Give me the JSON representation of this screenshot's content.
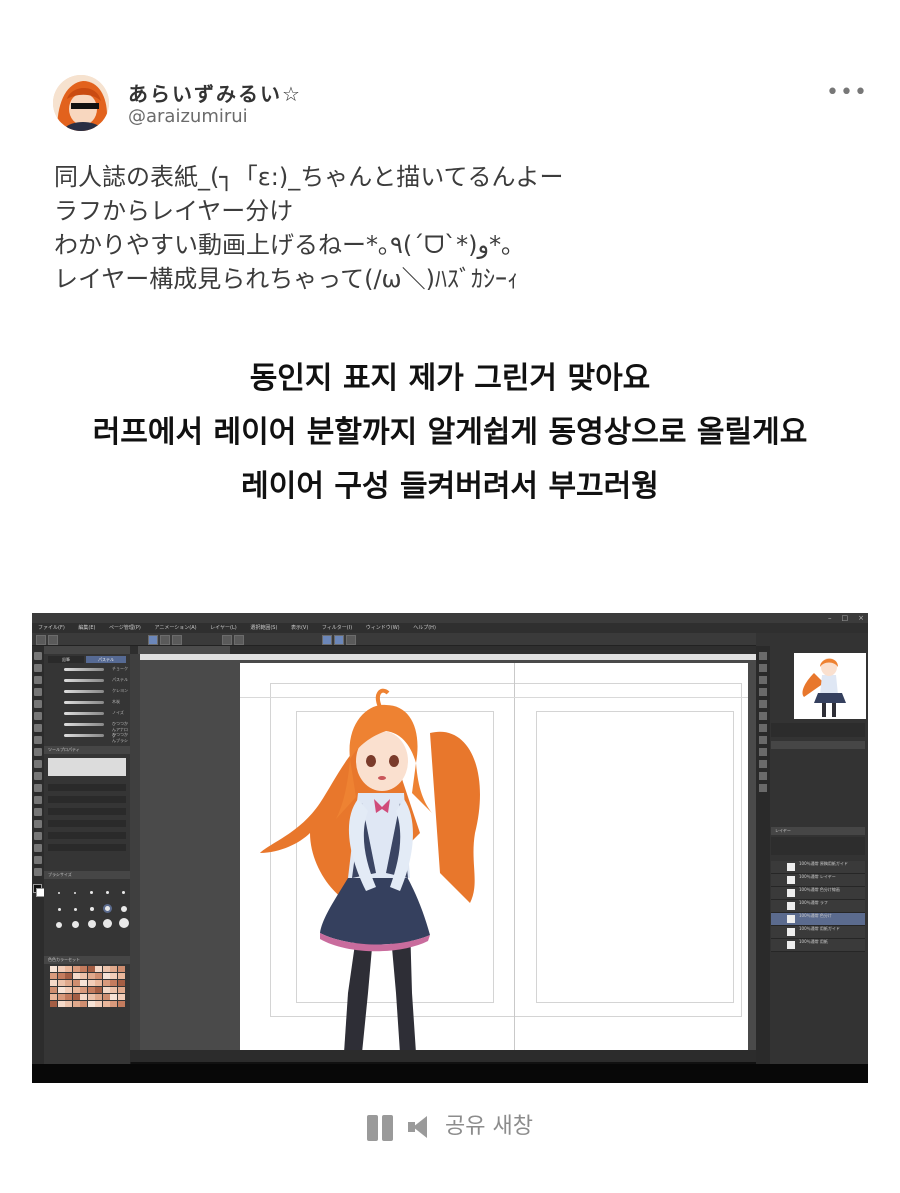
{
  "tweet": {
    "display_name": "あらいずみるい☆",
    "handle": "@araizumirui",
    "more_label": "•••",
    "lines": [
      "同人誌の表紙_(┐「ε:)_ちゃんと描いてるんよー",
      "ラフからレイヤー分け",
      "わかりやすい動画上げるねー*｡٩(ˊᗜˋ*)و*｡",
      "レイヤー構成見られちゃって(/ω＼)ﾊｽﾞｶｼｰｨ"
    ]
  },
  "translation": {
    "lines": [
      "동인지 표지 제가 그린거 맞아요",
      "러프에서 레이어 분할까지 알게쉽게 동영상으로 올릴게요",
      "레이어 구성 들켜버려서 부끄러웡"
    ]
  },
  "app": {
    "menu": [
      "ファイル(F)",
      "編集(E)",
      "ページ管理(P)",
      "アニメーション(A)",
      "レイヤー(L)",
      "選択範囲(S)",
      "表示(V)",
      "フィルター(I)",
      "ウィンドウ(W)",
      "ヘルプ(H)"
    ],
    "brushes": [
      "チョーク",
      "パステル",
      "クレヨン",
      "木炭",
      "ノイズ",
      "ひつつかんアナログ",
      "ひつつかんブラシ"
    ],
    "brush_tab_1": "鉛筆",
    "brush_tab_2": "パステル",
    "tool_property_tab": "ツールプロパティ",
    "brush_size_tab": "ブラシサイズ",
    "color_set_tab": "色色カラーセット",
    "layer_tab": "レイヤー",
    "layers": [
      "100％通常 原稿用紙ガイド",
      "100％通常 レイヤー",
      "100％通常 色分け線画",
      "100％通常 ラフ",
      "100％通常 色分け",
      "100％通常 用紙ガイド",
      "100％通常 用紙"
    ]
  },
  "share_bar": {
    "label": "공유 새창"
  },
  "colors": {
    "accent": "#6c87b9",
    "selected_layer": "#5b6b8e"
  }
}
